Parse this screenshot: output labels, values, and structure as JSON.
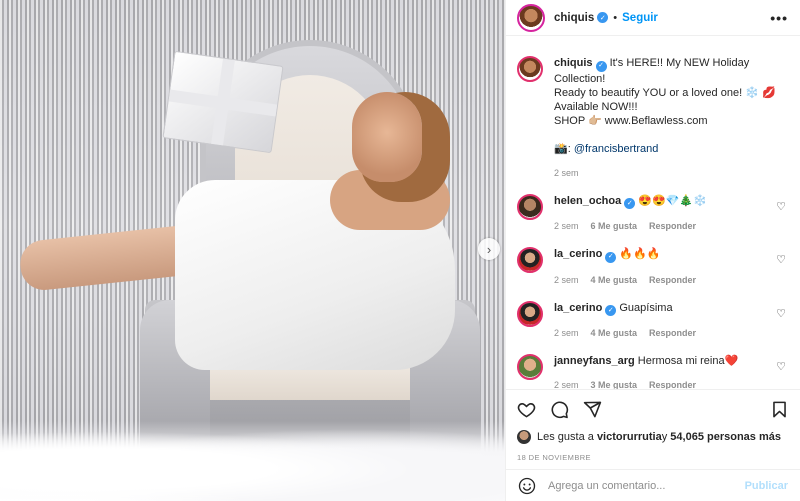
{
  "post": {
    "author": "chiquis",
    "follow_label": "Seguir",
    "dot": "•",
    "more_label": "•••"
  },
  "caption": {
    "username": "chiquis",
    "line1": " It's HERE!! My NEW Holiday Collection!",
    "line2": "Ready to beautify YOU or a loved one! ❄️ 💋",
    "line3": "Available NOW!!!",
    "line4": "SHOP 👉🏼 www.Beflawless.com",
    "photo_credit_icon": "📸",
    "photo_credit": "@francisbertrand",
    "time": "2 sem"
  },
  "comments": [
    {
      "username": "helen_ochoa",
      "verified": true,
      "text": "😍😍💎🎄❄️",
      "time": "2 sem",
      "likes": "6 Me gusta",
      "reply": "Responder"
    },
    {
      "username": "la_cerino",
      "verified": true,
      "text": "🔥🔥🔥",
      "time": "2 sem",
      "likes": "4 Me gusta",
      "reply": "Responder"
    },
    {
      "username": "la_cerino",
      "verified": true,
      "text": "Guapísima",
      "time": "2 sem",
      "likes": "4 Me gusta",
      "reply": "Responder"
    },
    {
      "username": "janneyfans_arg",
      "verified": false,
      "text": "Hermosa mi reina❤️",
      "time": "2 sem",
      "likes": "3 Me gusta",
      "reply": "Responder"
    }
  ],
  "likes": {
    "prefix": "Les gusta a ",
    "user": "victorurrutia",
    "middle": " y ",
    "count": "54,065 personas más"
  },
  "date": "18 DE NOVIEMBRE",
  "add_comment": {
    "placeholder": "Agrega un comentario...",
    "publish_label": "Publicar"
  },
  "icons": {
    "verified": "verified-badge-icon",
    "more": "more-options-icon",
    "heart": "heart-icon",
    "comment": "comment-icon",
    "share": "share-icon",
    "bookmark": "bookmark-icon",
    "emoji": "emoji-icon",
    "next": "chevron-right-icon"
  },
  "colors": {
    "link_blue": "#0095f6",
    "verified_blue": "#3897f0",
    "muted_text": "#8e8e8e",
    "publish_disabled": "#b2dffc"
  }
}
